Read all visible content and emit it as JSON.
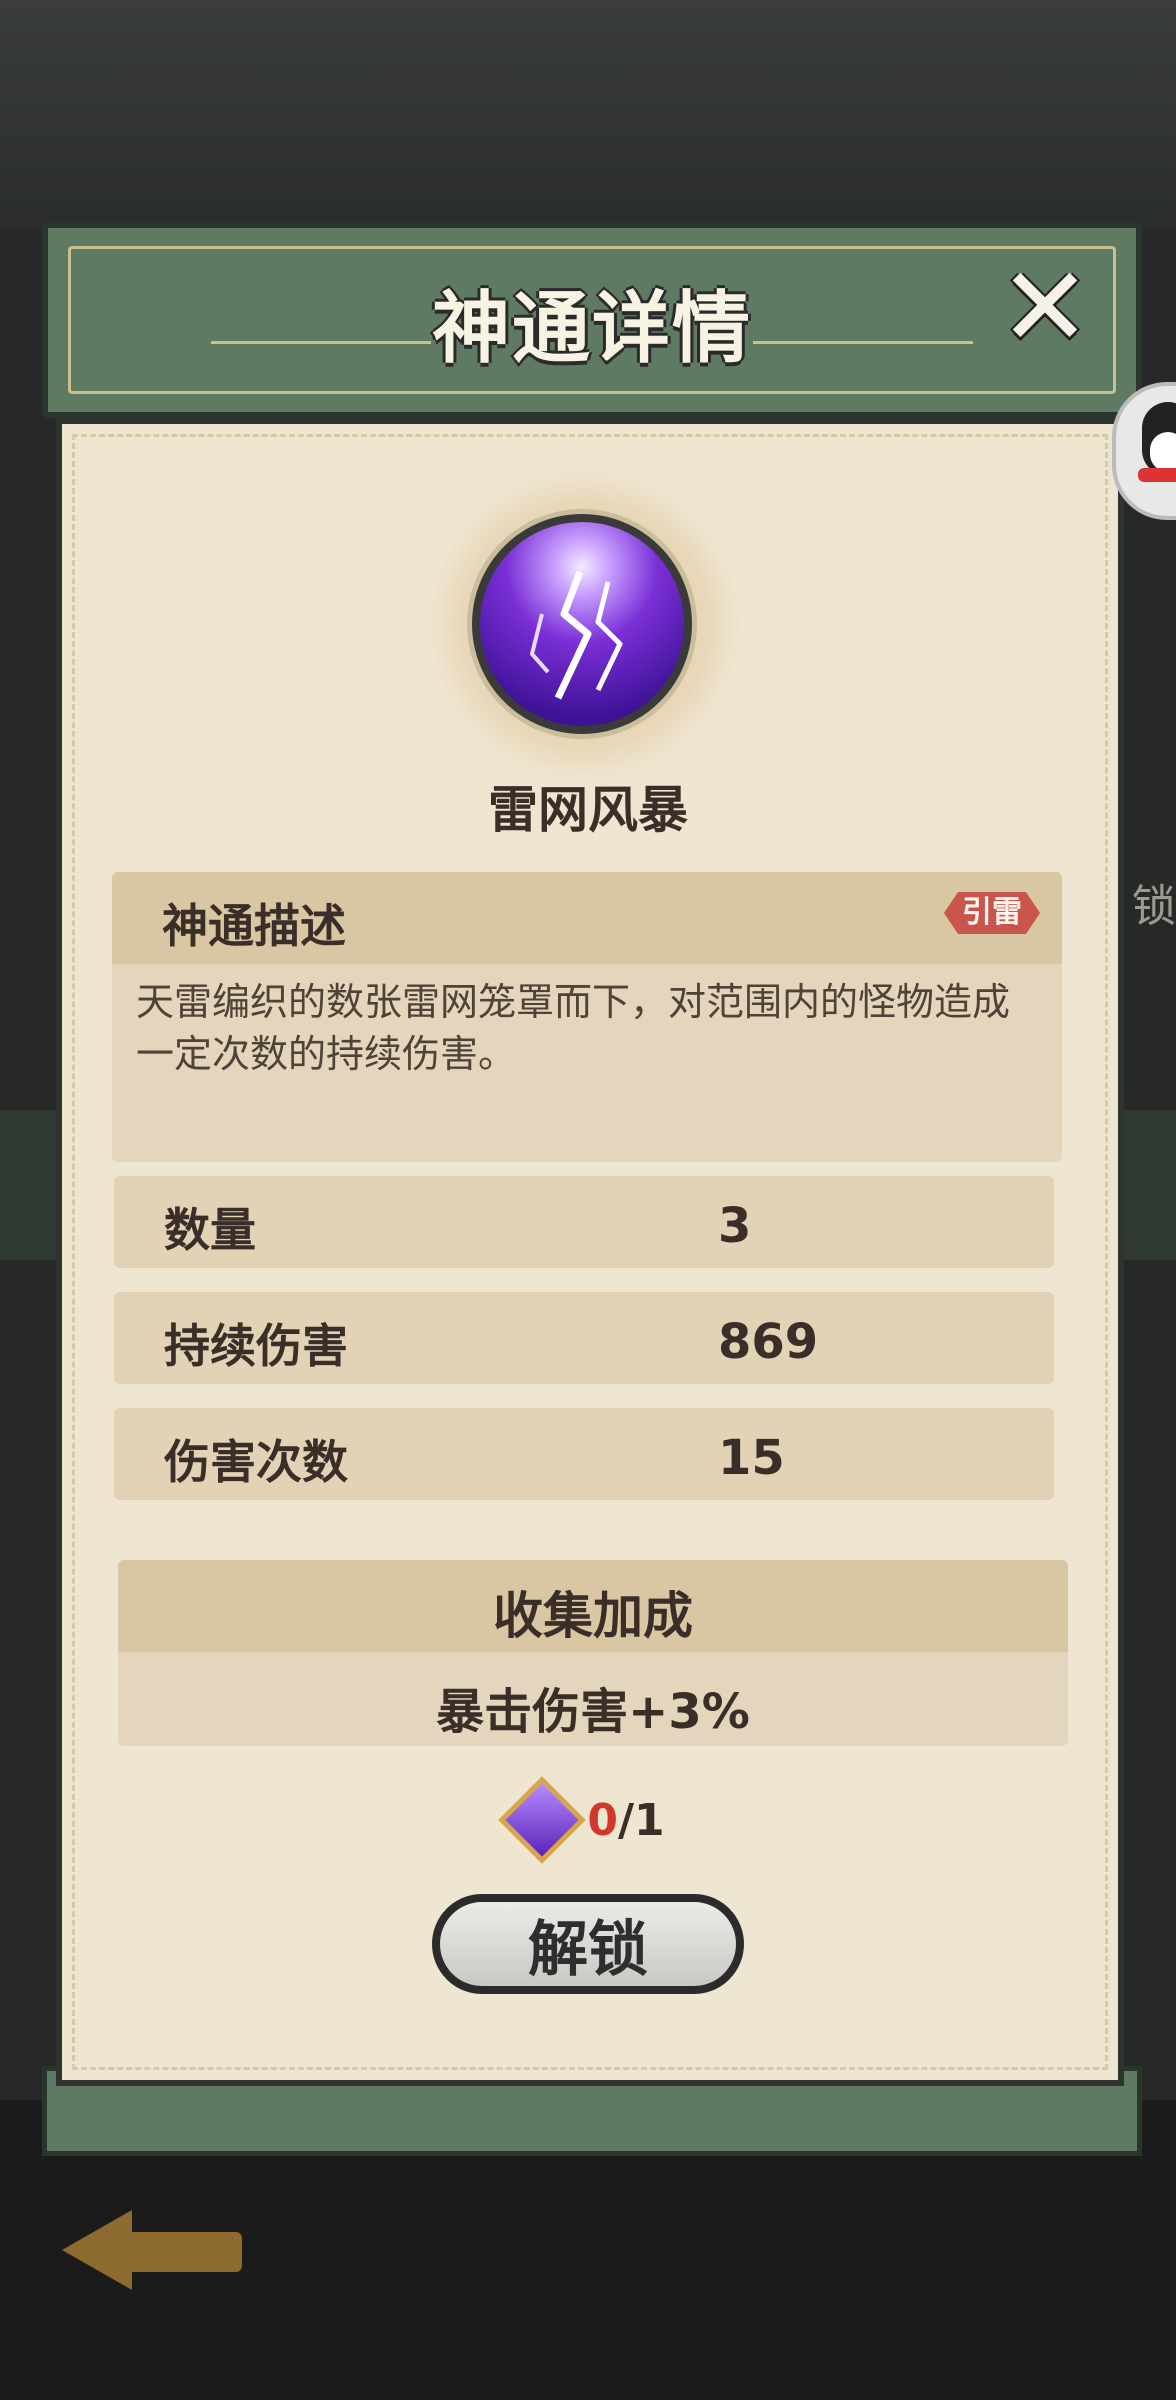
{
  "header": {
    "title": "神通详情",
    "close_icon": "close-x-icon"
  },
  "skill": {
    "name": "雷网风暴",
    "icon": "lightning-orb-icon"
  },
  "description": {
    "title": "神通描述",
    "tag": "引雷",
    "text": "天雷编织的数张雷网笼罩而下，对范围内的怪物造成一定次数的持续伤害。"
  },
  "stats": [
    {
      "label": "数量",
      "value": "3"
    },
    {
      "label": "持续伤害",
      "value": "869"
    },
    {
      "label": "伤害次数",
      "value": "15"
    }
  ],
  "collection_bonus": {
    "title": "收集加成",
    "value": "暴击伤害+3%"
  },
  "cost": {
    "icon": "purple-gem-icon",
    "have": "0",
    "need": "/1"
  },
  "unlock_button": {
    "label": "解锁"
  },
  "side_text_right": "锁",
  "colors": {
    "header": "#5f7a63",
    "panel": "#efe6d2",
    "tag": "#c9554c",
    "cost_have": "#d2382a"
  }
}
